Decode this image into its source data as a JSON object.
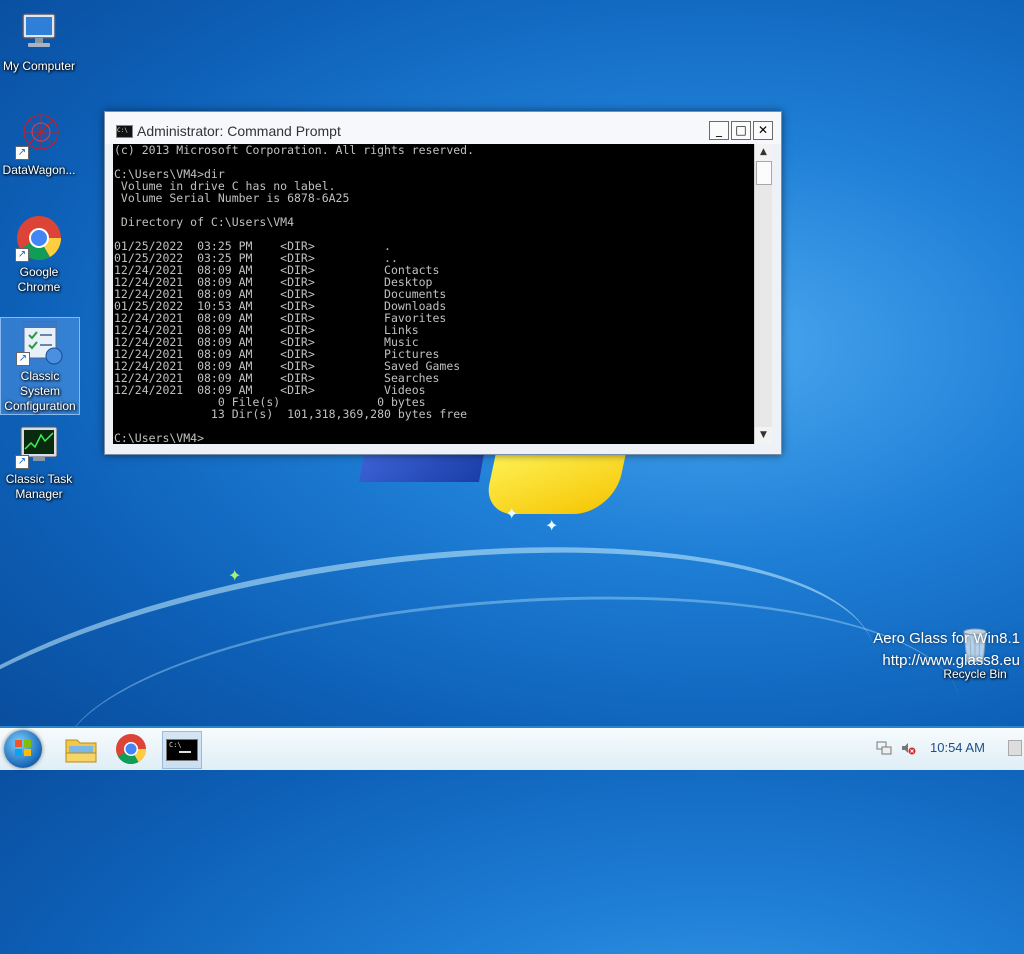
{
  "desktop": {
    "icons": [
      {
        "label": "My Computer"
      },
      {
        "label": "DataWagon..."
      },
      {
        "label": "Google Chrome"
      },
      {
        "label": "Classic System Configuration"
      },
      {
        "label": "Classic Task Manager"
      },
      {
        "label": "Recycle Bin"
      }
    ]
  },
  "watermark": {
    "line1": "Aero Glass for Win8.1",
    "line2": "http://www.glass8.eu"
  },
  "cmd_window": {
    "title": "Administrator: Command Prompt",
    "title_icon_text": "C:\\",
    "buttons": {
      "minimize": "_",
      "maximize": "□",
      "close": "✕"
    },
    "console_lines": [
      "(c) 2013 Microsoft Corporation. All rights reserved.",
      "",
      "C:\\Users\\VM4>dir",
      " Volume in drive C has no label.",
      " Volume Serial Number is 6878-6A25",
      "",
      " Directory of C:\\Users\\VM4",
      "",
      "01/25/2022  03:25 PM    <DIR>          .",
      "01/25/2022  03:25 PM    <DIR>          ..",
      "12/24/2021  08:09 AM    <DIR>          Contacts",
      "12/24/2021  08:09 AM    <DIR>          Desktop",
      "12/24/2021  08:09 AM    <DIR>          Documents",
      "01/25/2022  10:53 AM    <DIR>          Downloads",
      "12/24/2021  08:09 AM    <DIR>          Favorites",
      "12/24/2021  08:09 AM    <DIR>          Links",
      "12/24/2021  08:09 AM    <DIR>          Music",
      "12/24/2021  08:09 AM    <DIR>          Pictures",
      "12/24/2021  08:09 AM    <DIR>          Saved Games",
      "12/24/2021  08:09 AM    <DIR>          Searches",
      "12/24/2021  08:09 AM    <DIR>          Videos",
      "               0 File(s)              0 bytes",
      "              13 Dir(s)  101,318,369,280 bytes free",
      "",
      "C:\\Users\\VM4>"
    ],
    "scroll_up": "▲",
    "scroll_down": "▼"
  },
  "taskbar": {
    "apps": [
      {
        "name": "File Explorer",
        "icon": "folder-icon"
      },
      {
        "name": "Google Chrome",
        "icon": "chrome-icon"
      },
      {
        "name": "Command Prompt",
        "icon": "cmd-icon",
        "icon_text": "C:\\"
      }
    ],
    "clock": "10:54 AM"
  },
  "colors": {
    "console_bg": "#000000",
    "console_fg": "#c0c0c0",
    "taskbar_accent": "#2a86c8"
  }
}
